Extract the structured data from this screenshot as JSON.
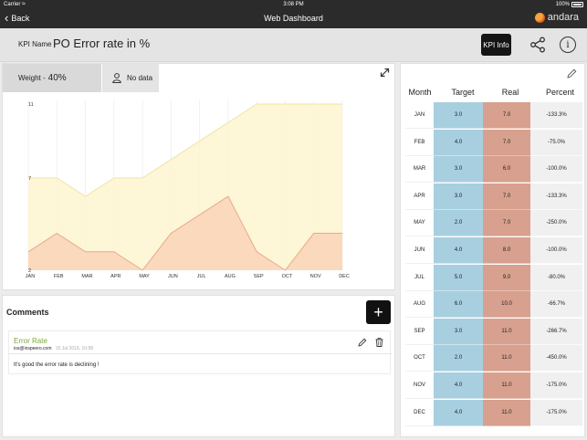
{
  "status_bar": {
    "carrier": "Carrier",
    "time": "3:08 PM",
    "battery": "100%"
  },
  "nav": {
    "back_label": "Back",
    "title": "Web Dashboard",
    "logo_text": "andara"
  },
  "kpi": {
    "label": "KPI Name :",
    "name": "PO Error rate in %",
    "info_button": "KPI Info",
    "weight_label": "Weight - ",
    "weight_value": "40%",
    "responsible": "No data"
  },
  "chart_data": {
    "type": "area",
    "categories": [
      "JAN",
      "FEB",
      "MAR",
      "APR",
      "MAY",
      "JUN",
      "JUL",
      "AUG",
      "SEP",
      "OCT",
      "NOV",
      "DEC"
    ],
    "y_tick_labels": [
      "2",
      "7",
      "11"
    ],
    "ylim": [
      2,
      11
    ],
    "series": [
      {
        "values": [
          3,
          4,
          3,
          3,
          2,
          4,
          5,
          6,
          3,
          2,
          4,
          4
        ],
        "color": "#f9d3b8"
      },
      {
        "values": [
          7,
          7,
          6,
          7,
          7,
          8,
          9,
          10,
          11,
          11,
          11,
          11
        ],
        "color": "#fdf5d0"
      }
    ],
    "grid": true
  },
  "comments": {
    "title": "Comments",
    "add_label": "+",
    "items": [
      {
        "title": "Error Rate",
        "author": "ios@inspeero.com",
        "date": "15 Jul 2016, 10:58",
        "text": "It's good the error rate is declining !"
      }
    ]
  },
  "table": {
    "headers": [
      "Month",
      "Target",
      "Real",
      "Percent"
    ],
    "rows": [
      {
        "month": "JAN",
        "target": "3.0",
        "real": "7.0",
        "percent": "-133.3%"
      },
      {
        "month": "FEB",
        "target": "4.0",
        "real": "7.0",
        "percent": "-75.0%"
      },
      {
        "month": "MAR",
        "target": "3.0",
        "real": "6.0",
        "percent": "-100.0%"
      },
      {
        "month": "APR",
        "target": "3.0",
        "real": "7.0",
        "percent": "-133.3%"
      },
      {
        "month": "MAY",
        "target": "2.0",
        "real": "7.0",
        "percent": "-250.0%"
      },
      {
        "month": "JUN",
        "target": "4.0",
        "real": "8.0",
        "percent": "-100.0%"
      },
      {
        "month": "JUL",
        "target": "5.0",
        "real": "9.0",
        "percent": "-80.0%"
      },
      {
        "month": "AUG",
        "target": "6.0",
        "real": "10.0",
        "percent": "-66.7%"
      },
      {
        "month": "SEP",
        "target": "3.0",
        "real": "11.0",
        "percent": "-266.7%"
      },
      {
        "month": "OCT",
        "target": "2.0",
        "real": "11.0",
        "percent": "-450.0%"
      },
      {
        "month": "NOV",
        "target": "4.0",
        "real": "11.0",
        "percent": "-175.0%"
      },
      {
        "month": "DEC",
        "target": "4.0",
        "real": "11.0",
        "percent": "-175.0%"
      }
    ]
  }
}
